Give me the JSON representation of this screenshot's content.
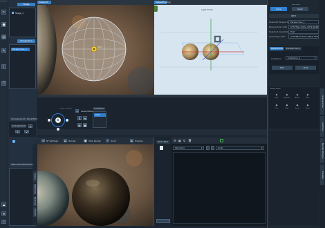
{
  "app": {
    "title": "Workspace"
  },
  "left_panel": {
    "stage_tab": "Stage",
    "stage_item": "Stage_1",
    "perspective_tab": "Perspective",
    "perspective_item": "Perspective_1",
    "arrangement_tab": "Arrangement | Decal/Pick",
    "arrangement_item": "Arrangement_1",
    "attached_tab": "Attached Assemblies"
  },
  "vertical_tabs": [
    "Scene",
    "Materials",
    "Textures",
    "Presets"
  ],
  "viewport1": {
    "tab": "Viewport",
    "label": "Test"
  },
  "viewport2": {
    "tab": "Stage/Plugin",
    "label": "Light Portal"
  },
  "controls": {
    "gimbal_label": "Gimbal + Rotation",
    "assemblies_label": "Assemblies",
    "collection_tab": "Collection",
    "collection_item": "Post"
  },
  "render_toolbar": {
    "settings": "RT Settings",
    "render": "Render",
    "stop": "Stop Render",
    "quick": "Quick",
    "preview": "Preview"
  },
  "text_panel": {
    "tab": "TexT_Type"
  },
  "output_panel": {
    "dropdown1": "Standard",
    "dropdown2": "Axial"
  },
  "right_panel": {
    "top_buttons": {
      "save": "Save",
      "load": "Load Saved",
      "sub": "Clear"
    },
    "header": "INFO",
    "props": [
      {
        "label": "Selected Perspective",
        "value": "Perspective_1"
      },
      {
        "label": "Perspective UUID",
        "value": "0757f9ec-692e-4d79-9648-7f604d97"
      },
      {
        "label": "Selected Assembly",
        "value": "Post"
      },
      {
        "label": "Assembly UUID",
        "value": "2a39487a-0212-48a3-a76f-a8e0d7fa0e2f"
      }
    ],
    "tabs": [
      "Perspective",
      "Perspective_1"
    ],
    "collection_label": "Collection",
    "collection_value": "Collection_1",
    "btn_a": "Pick",
    "btn_b": "Post",
    "effects_header": "Render Effects",
    "effects": [
      "Light",
      "Exposure",
      "Bloom",
      "Blur",
      "Color",
      "Edge",
      "Fringe",
      "Grain"
    ]
  },
  "side_tabs": [
    "Appearance",
    "Settings",
    "Render Plugins",
    "Presets"
  ],
  "colors": {
    "accent": "#2f7fd0",
    "bg": "#1d2733",
    "panel": "#27323f"
  }
}
